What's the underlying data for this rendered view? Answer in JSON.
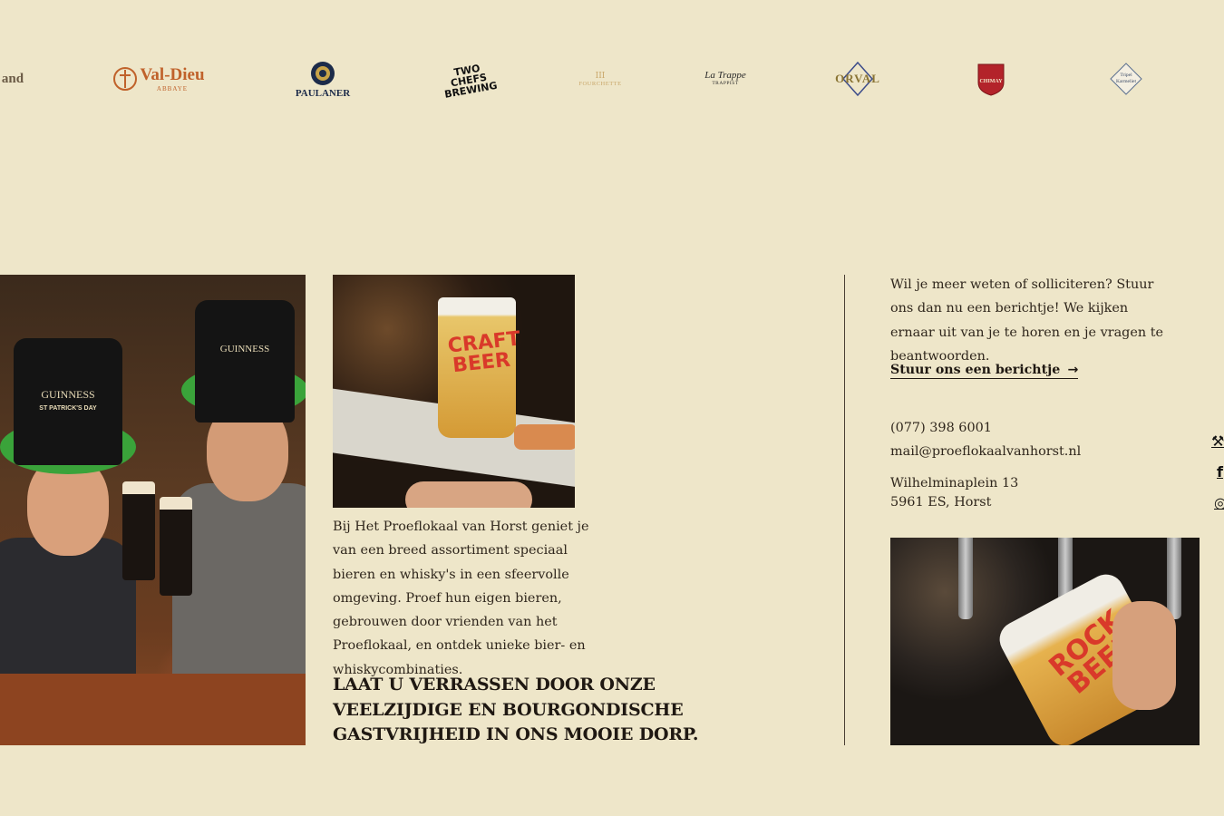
{
  "brand_logos": [
    {
      "name": "brand-logo-cut-left",
      "text": "and"
    },
    {
      "name": "val-dieu",
      "text": "Val-Dieu",
      "sub": "ABBAYE"
    },
    {
      "name": "paulaner",
      "text": "PAULANER"
    },
    {
      "name": "two-chefs-brewing",
      "text": "TWO CHEFS BREWING"
    },
    {
      "name": "fourchette",
      "text": "FOURCHETTE"
    },
    {
      "name": "la-trappe",
      "text": "La Trappe",
      "sub": "TRAPPIST"
    },
    {
      "name": "orval",
      "text": "ORVAL"
    },
    {
      "name": "chimay",
      "text": "CHIMAY"
    },
    {
      "name": "tripel-karmeliet",
      "text": "Tripel Karmeliet"
    }
  ],
  "intro": {
    "paragraph": "Bij Het Proeflokaal van Horst geniet je van een breed assortiment speciaal bieren en whisky's in een sfeervolle omgeving. Proef hun eigen bieren, gebrouwen door vrienden van het Proeflokaal, en ontdek unieke bier- en whiskycombinaties.",
    "headline": "LAAT U VERRASSEN DOOR ONZE VEELZIJDIGE EN BOURGONDISCHE GASTVRIJHEID IN ONS MOOIE DORP."
  },
  "photos": {
    "left_hats": "GUINNESS",
    "left_hat_sub": "ST PATRICK'S DAY",
    "middle_glass": "CRAFT BEER",
    "right_glass": "ROCK BEER"
  },
  "contact": {
    "text": "Wil je meer weten of solliciteren? Stuur ons dan nu een berichtje! We kijken ernaar uit van je te horen en je vragen te beantwoorden.",
    "cta_label": "Stuur ons een berichtje",
    "cta_arrow": "→",
    "phone": "(077) 398 6001",
    "email": "mail@proeflokaalvanhorst.nl",
    "address_street": "Wilhelminaplein 13",
    "address_city": "5961 ES, Horst"
  },
  "social": [
    {
      "icon": "untappd-icon",
      "glyph": "⚒"
    },
    {
      "icon": "facebook-icon",
      "glyph": "f"
    },
    {
      "icon": "instagram-icon",
      "glyph": "◎"
    }
  ],
  "colors": {
    "background": "#eee6c9",
    "text": "#2a2118",
    "val_dieu": "#c0622b",
    "paulaner": "#1c2b4a",
    "orval": "#8a7434",
    "chimay": "#b3232a"
  }
}
